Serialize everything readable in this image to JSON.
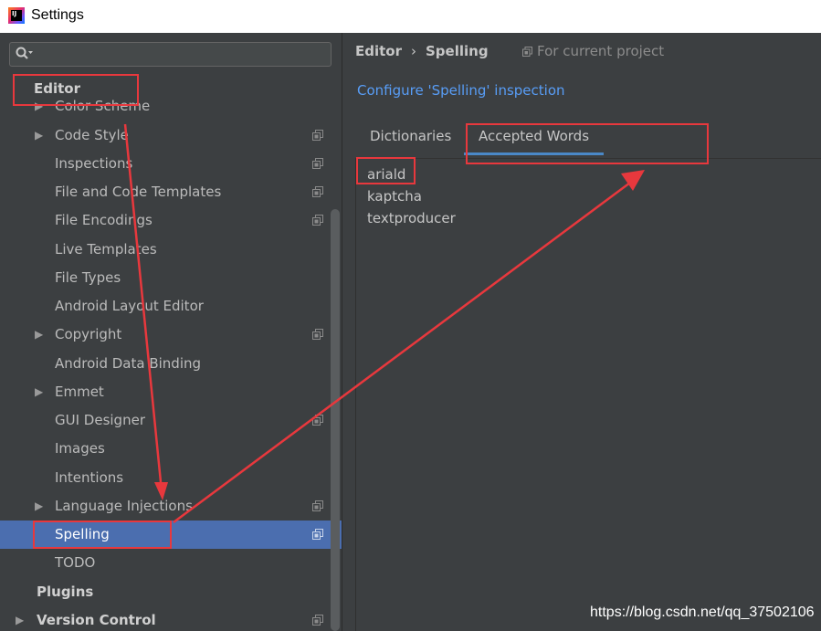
{
  "window": {
    "title": "Settings"
  },
  "search": {
    "value": ""
  },
  "sidebar": {
    "items": [
      {
        "label": "Editor",
        "bold": true,
        "level": 0,
        "expandable": false,
        "project_icon": false,
        "selected": false
      },
      {
        "label": "Color Scheme",
        "level": 1,
        "expandable": true,
        "project_icon": false,
        "selected": false
      },
      {
        "label": "Code Style",
        "level": 1,
        "expandable": true,
        "project_icon": true,
        "selected": false
      },
      {
        "label": "Inspections",
        "level": 1,
        "expandable": false,
        "project_icon": true,
        "selected": false
      },
      {
        "label": "File and Code Templates",
        "level": 1,
        "expandable": false,
        "project_icon": true,
        "selected": false
      },
      {
        "label": "File Encodings",
        "level": 1,
        "expandable": false,
        "project_icon": true,
        "selected": false
      },
      {
        "label": "Live Templates",
        "level": 1,
        "expandable": false,
        "project_icon": false,
        "selected": false
      },
      {
        "label": "File Types",
        "level": 1,
        "expandable": false,
        "project_icon": false,
        "selected": false
      },
      {
        "label": "Android Layout Editor",
        "level": 1,
        "expandable": false,
        "project_icon": false,
        "selected": false
      },
      {
        "label": "Copyright",
        "level": 1,
        "expandable": true,
        "project_icon": true,
        "selected": false
      },
      {
        "label": "Android Data Binding",
        "level": 1,
        "expandable": false,
        "project_icon": false,
        "selected": false
      },
      {
        "label": "Emmet",
        "level": 1,
        "expandable": true,
        "project_icon": false,
        "selected": false
      },
      {
        "label": "GUI Designer",
        "level": 1,
        "expandable": false,
        "project_icon": true,
        "selected": false
      },
      {
        "label": "Images",
        "level": 1,
        "expandable": false,
        "project_icon": false,
        "selected": false
      },
      {
        "label": "Intentions",
        "level": 1,
        "expandable": false,
        "project_icon": false,
        "selected": false
      },
      {
        "label": "Language Injections",
        "level": 1,
        "expandable": true,
        "project_icon": true,
        "selected": false
      },
      {
        "label": "Spelling",
        "level": 1,
        "expandable": false,
        "project_icon": true,
        "selected": true
      },
      {
        "label": "TODO",
        "level": 1,
        "expandable": false,
        "project_icon": false,
        "selected": false
      },
      {
        "label": "Plugins",
        "bold": true,
        "level": 0,
        "expandable": false,
        "project_icon": false,
        "selected": false
      },
      {
        "label": "Version Control",
        "bold": true,
        "level": 0,
        "expandable": true,
        "project_icon": true,
        "selected": false
      }
    ]
  },
  "breadcrumb": {
    "parent": "Editor",
    "separator": "›",
    "current": "Spelling"
  },
  "scope": {
    "label": "For current project"
  },
  "config_link": {
    "label": "Configure 'Spelling' inspection"
  },
  "tabs": [
    {
      "label": "Dictionaries",
      "active": false
    },
    {
      "label": "Accepted Words",
      "active": true
    }
  ],
  "accepted_words": [
    "ariald",
    "kaptcha",
    "textproducer"
  ],
  "watermark": "https://blog.csdn.net/qq_37502106",
  "colors": {
    "selection": "#4b6eaf",
    "link": "#589df6",
    "annotation": "#e8383d",
    "tab_underline": "#4a88c7"
  }
}
